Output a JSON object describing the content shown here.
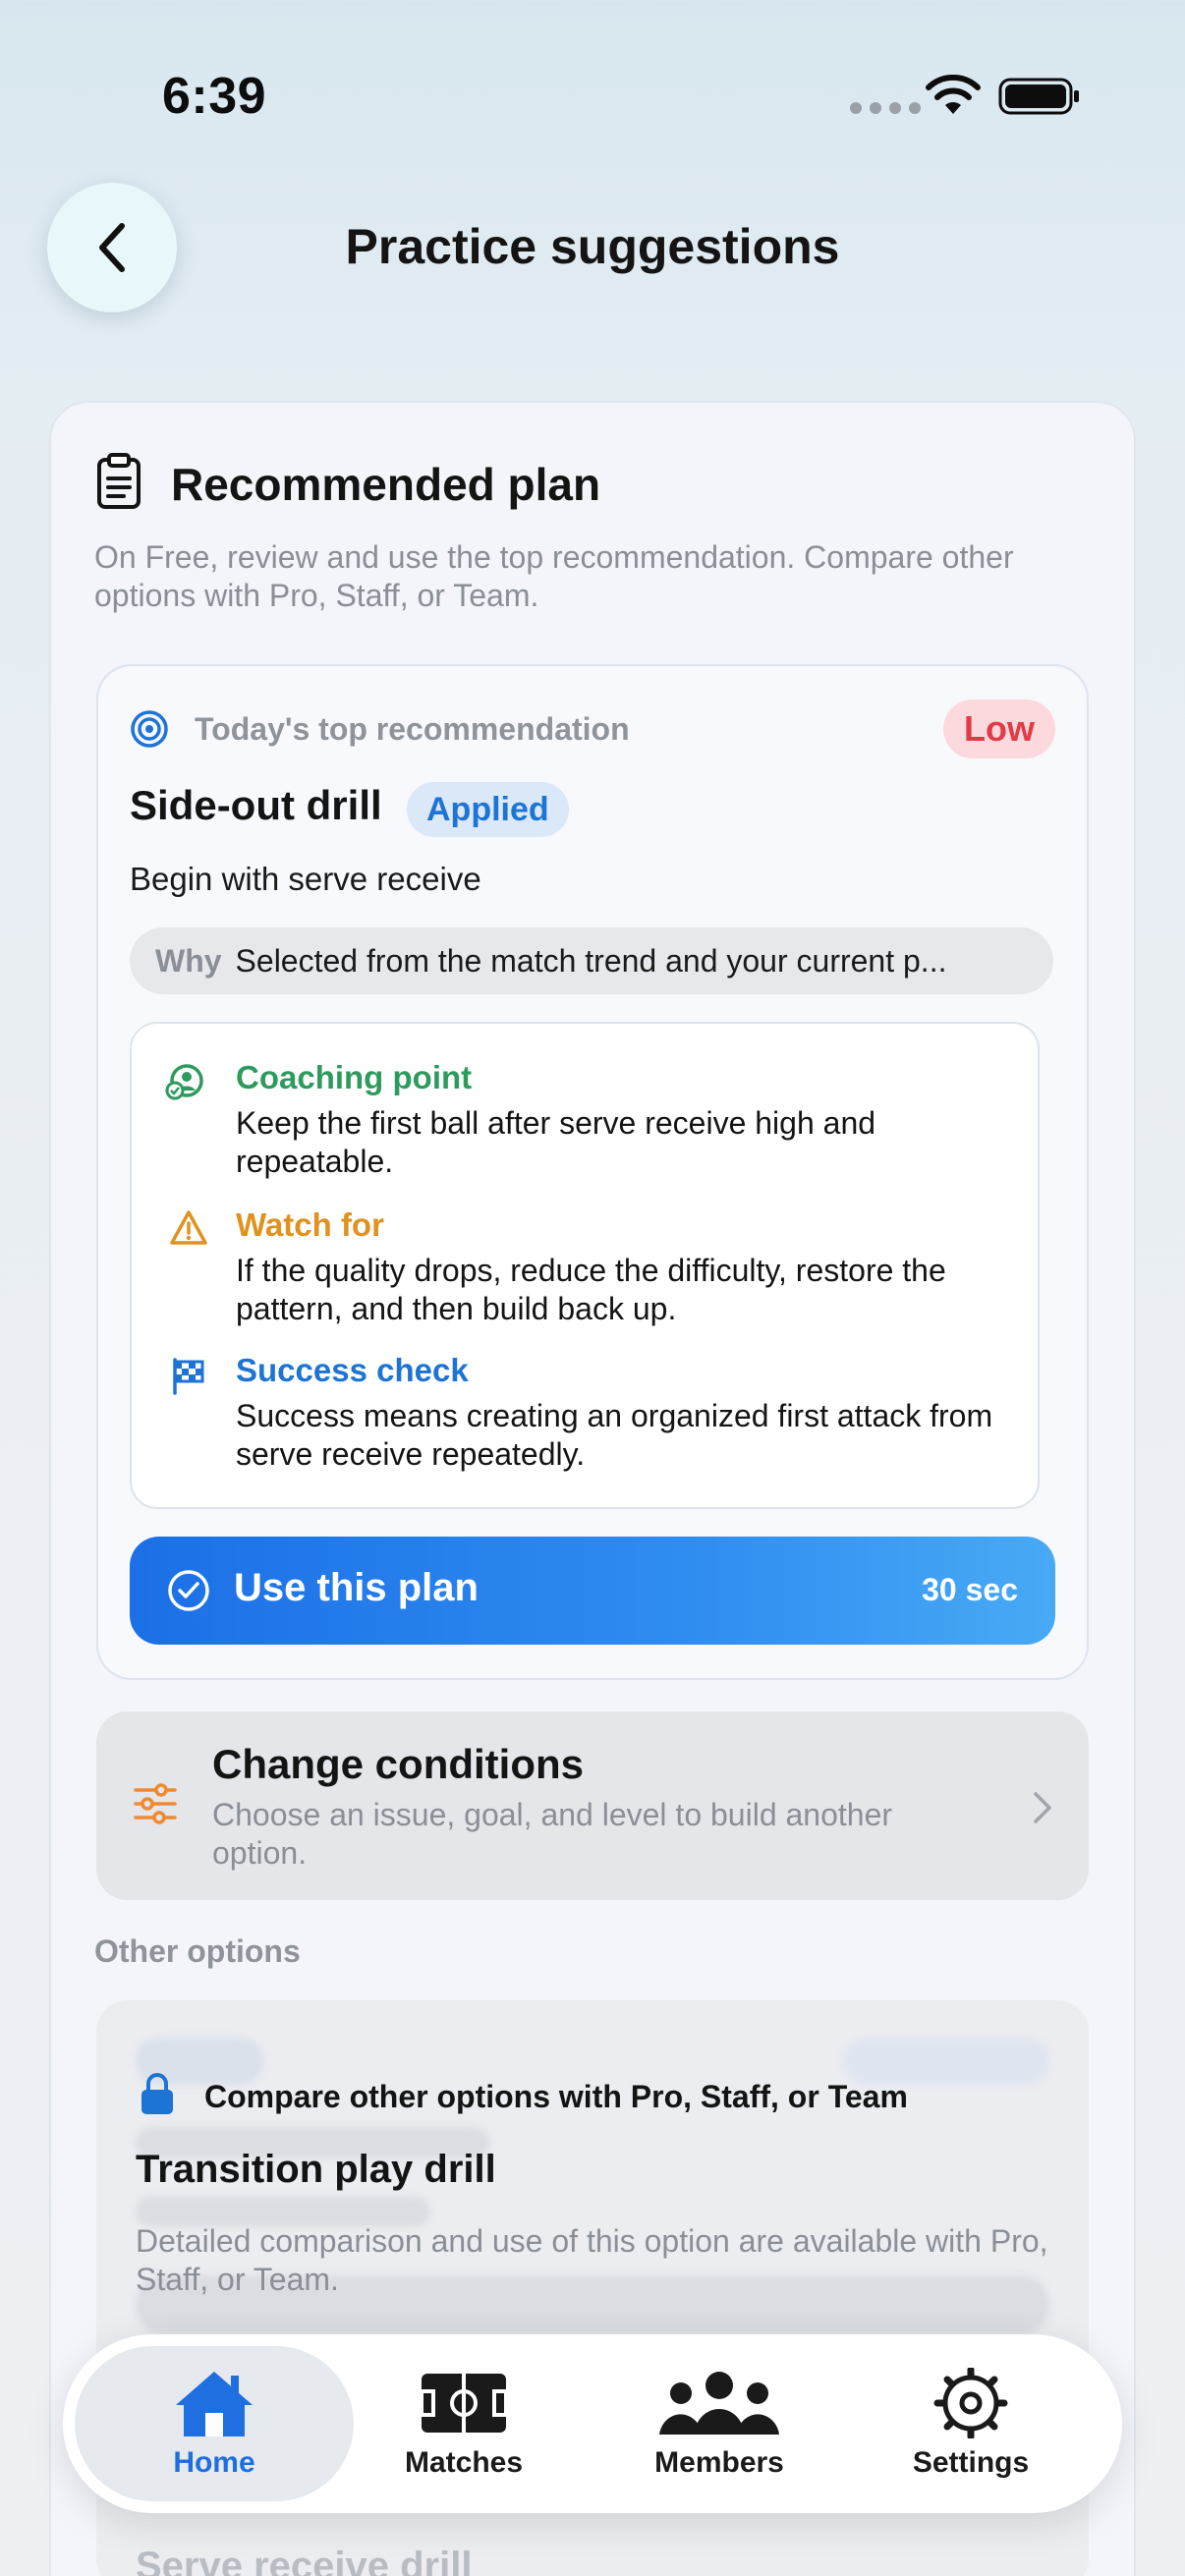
{
  "status_bar": {
    "time": "6:39"
  },
  "header": {
    "title": "Practice suggestions"
  },
  "plan": {
    "title": "Recommended plan",
    "description": "On Free, review and use the top recommendation. Compare other options with Pro, Staff, or Team."
  },
  "recommendation": {
    "label": "Today's top recommendation",
    "priority": "Low",
    "drill_title": "Side-out drill",
    "applied": "Applied",
    "subtitle": "Begin with serve receive",
    "why_label": "Why",
    "why_text": "Selected from the match trend and your current p...",
    "points": [
      {
        "title": "Coaching point",
        "text": "Keep the first ball after serve receive high and repeatable.",
        "color": "#2e9a5e",
        "icon": "coach-icon"
      },
      {
        "title": "Watch for",
        "text": "If the quality drops, reduce the difficulty, restore the pattern, and then build back up.",
        "color": "#e0921e",
        "icon": "warning-icon"
      },
      {
        "title": "Success check",
        "text": "Success means creating an organized first attack from serve receive repeatedly.",
        "color": "#1e74d4",
        "icon": "checkered-flag-icon"
      }
    ],
    "button_label": "Use this plan",
    "button_time": "30 sec"
  },
  "change_conditions": {
    "title": "Change conditions",
    "description": "Choose an issue, goal, and level to build another option."
  },
  "other_options": {
    "heading": "Other options",
    "lock_label": "Compare other options with Pro, Staff, or Team",
    "locked_title": "Transition play drill",
    "locked_description": "Detailed comparison and use of this option are available with Pro, Staff, or Team.",
    "next_title": "Serve receive drill"
  },
  "tabs": [
    {
      "label": "Home",
      "icon": "home-icon",
      "active": true
    },
    {
      "label": "Matches",
      "icon": "court-icon",
      "active": false
    },
    {
      "label": "Members",
      "icon": "members-icon",
      "active": false
    },
    {
      "label": "Settings",
      "icon": "gear-icon",
      "active": false
    }
  ],
  "colors": {
    "accent": "#1f6fe0",
    "priority_low": "#e23a46",
    "applied": "#1e74d4"
  }
}
